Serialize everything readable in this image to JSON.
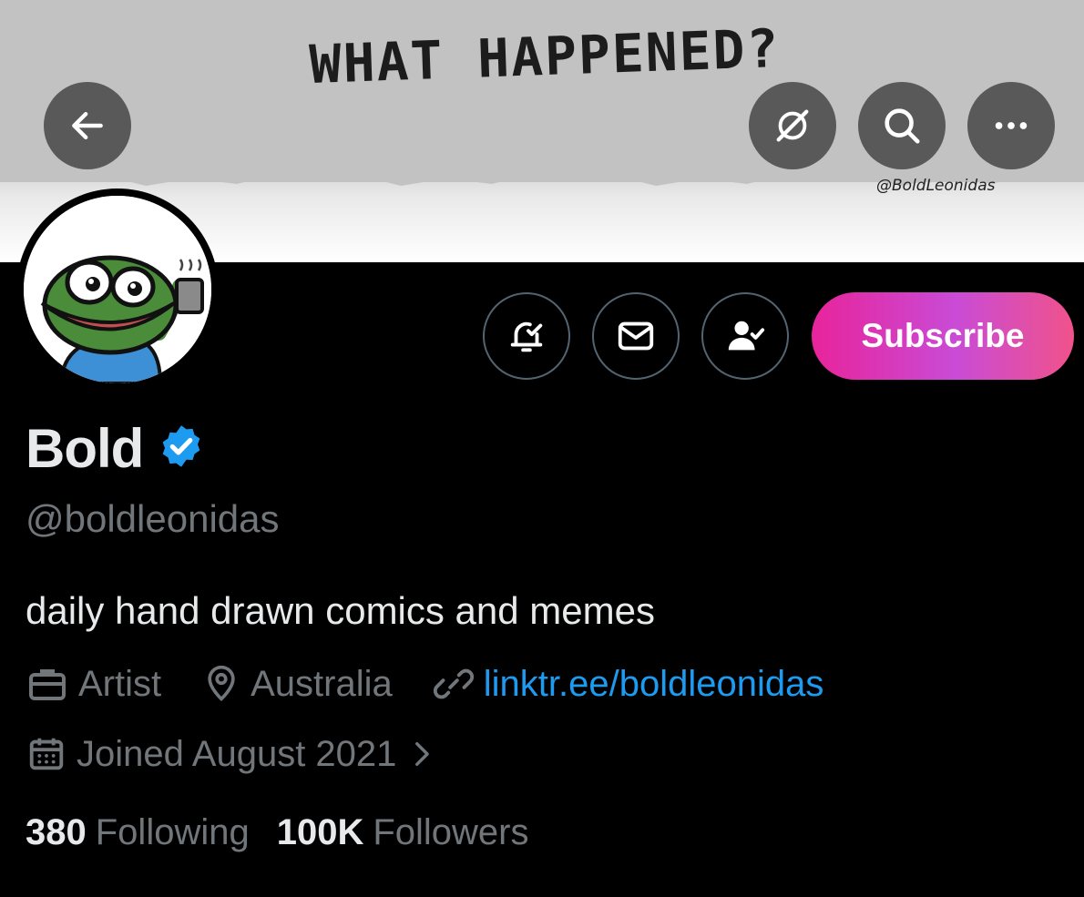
{
  "banner": {
    "headline": "WHAT HAPPENED?",
    "credit": "@BoldLeonidas"
  },
  "header_buttons": {
    "back_icon": "arrow-left-icon",
    "grok_icon": "grok-icon",
    "search_icon": "search-icon",
    "more_icon": "more-horizontal-icon"
  },
  "actions": {
    "notifications_icon": "bell-check-icon",
    "message_icon": "envelope-icon",
    "following_icon": "person-check-icon",
    "subscribe_label": "Subscribe"
  },
  "profile": {
    "display_name": "Bold",
    "handle": "@boldleonidas",
    "bio": "daily hand drawn comics and memes",
    "profession": "Artist",
    "location": "Australia",
    "link": "linktr.ee/boldleonidas",
    "joined": "Joined August 2021"
  },
  "stats": {
    "following_count": "380",
    "following_label": "Following",
    "followers_count": "100K",
    "followers_label": "Followers"
  },
  "colors": {
    "background": "#000000",
    "accent": "#1d9bf0",
    "muted_text": "#71767b",
    "subscribe_gradient_start": "#e8249b",
    "subscribe_gradient_end": "#f0528a"
  }
}
